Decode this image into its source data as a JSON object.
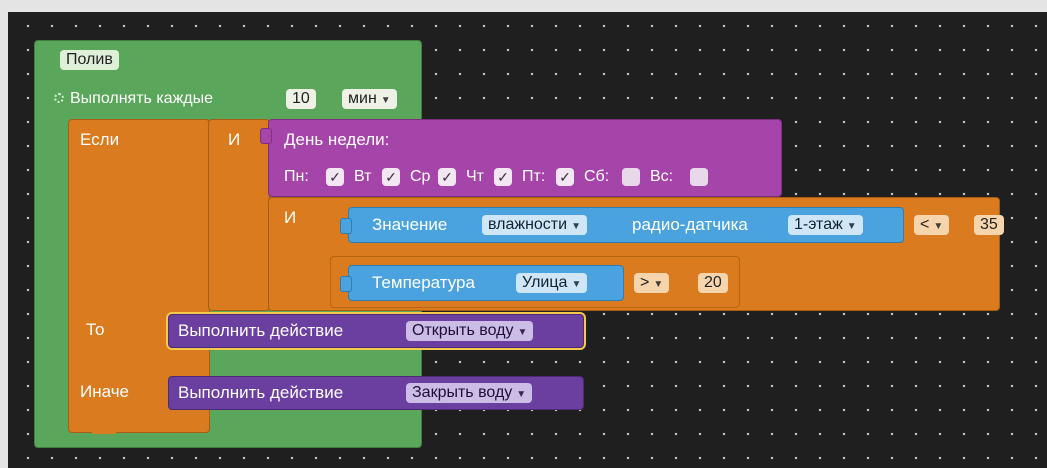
{
  "event": {
    "name": "Полив",
    "repeat_label": "Выполнять каждые",
    "interval_value": "10",
    "interval_unit": "мин"
  },
  "condition": {
    "if_label": "Если",
    "and_label_1": "И",
    "and_label_2": "И",
    "weekday": {
      "title": "День недели:",
      "days": [
        {
          "label": "Пн:",
          "checked": true
        },
        {
          "label": "Вт",
          "checked": true
        },
        {
          "label": "Ср",
          "checked": true
        },
        {
          "label": "Чт",
          "checked": true
        },
        {
          "label": "Пт:",
          "checked": true
        },
        {
          "label": "Сб:",
          "checked": false
        },
        {
          "label": "Вс:",
          "checked": false
        }
      ]
    },
    "humidity": {
      "label": "Значение",
      "param": "влажности",
      "source_label": "радио-датчика",
      "sensor": "1-этаж",
      "operator": "<",
      "value": "35"
    },
    "temperature": {
      "label": "Температура",
      "location": "Улица",
      "operator": ">",
      "value": "20"
    }
  },
  "then": {
    "label": "То",
    "action_label": "Выполнить действие",
    "action": "Открыть воду"
  },
  "else": {
    "label": "Иначе",
    "action_label": "Выполнить действие",
    "action": "Закрыть воду"
  },
  "colors": {
    "event": "#5aa65a",
    "logic": "#d97b1e",
    "weekday": "#a545a9",
    "sensor": "#4aa3df",
    "action": "#6a3fa0",
    "workspace": "#1f1f1f"
  },
  "icons": {
    "check": "✓",
    "dropdown": "▼",
    "repeat": "repeat-icon"
  }
}
